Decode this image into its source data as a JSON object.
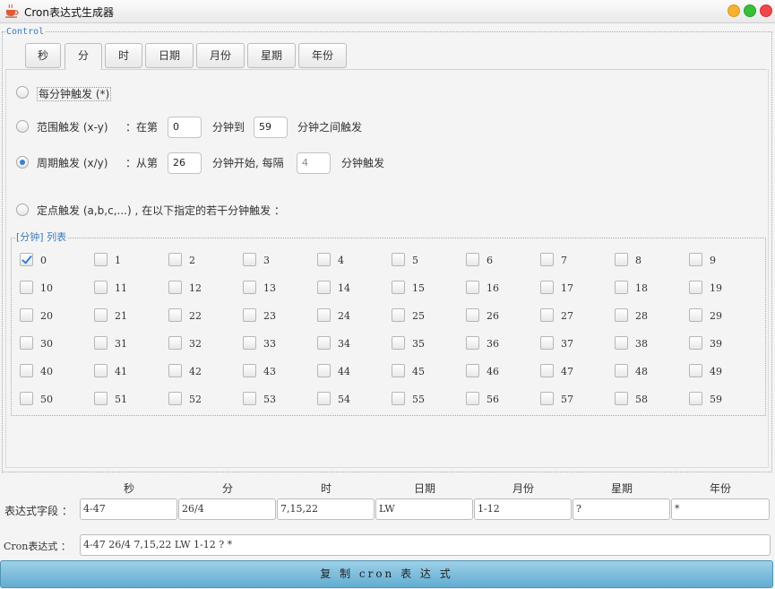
{
  "window": {
    "title": "Cron表达式生成器"
  },
  "control": {
    "legend": "Control"
  },
  "tabs": [
    {
      "label": "秒",
      "active": false
    },
    {
      "label": "分",
      "active": true
    },
    {
      "label": "时",
      "active": false
    },
    {
      "label": "日期",
      "active": false
    },
    {
      "label": "月份",
      "active": false
    },
    {
      "label": "星期",
      "active": false
    },
    {
      "label": "年份",
      "active": false
    }
  ],
  "minute": {
    "every": {
      "label": "每分钟触发 (*)",
      "selected": false
    },
    "range": {
      "label": "范围触发 (x-y)",
      "sep": "：在第",
      "from": "0",
      "mid": "分钟到",
      "to": "59",
      "suffix": "分钟之间触发",
      "selected": false
    },
    "cycle": {
      "label": "周期触发 (x/y)",
      "sep": "：从第",
      "start": "26",
      "mid": "分钟开始, 每隔",
      "interval": "4",
      "suffix": "分钟触发",
      "selected": true
    },
    "fixed": {
      "label": "定点触发 (a,b,c,...) , 在以下指定的若干分钟触发 ：",
      "selected": false
    },
    "list_legend": "[分钟] 列表",
    "checked": [
      0
    ]
  },
  "fields": {
    "row_label": "表达式字段 ：",
    "headers": [
      "秒",
      "分",
      "时",
      "日期",
      "月份",
      "星期",
      "年份"
    ],
    "values": [
      "4-47",
      "26/4",
      "7,15,22",
      "LW",
      "1-12",
      "?",
      "*"
    ]
  },
  "cron": {
    "label": "Cron表达式 ：",
    "value": "4-47 26/4 7,15,22 LW 1-12 ? *"
  },
  "copy_button": "复 制 cron 表 达 式",
  "colors": {
    "accent": "#3b7fd0",
    "legend": "#3a7bbf",
    "copy_button": "#62acd1"
  }
}
